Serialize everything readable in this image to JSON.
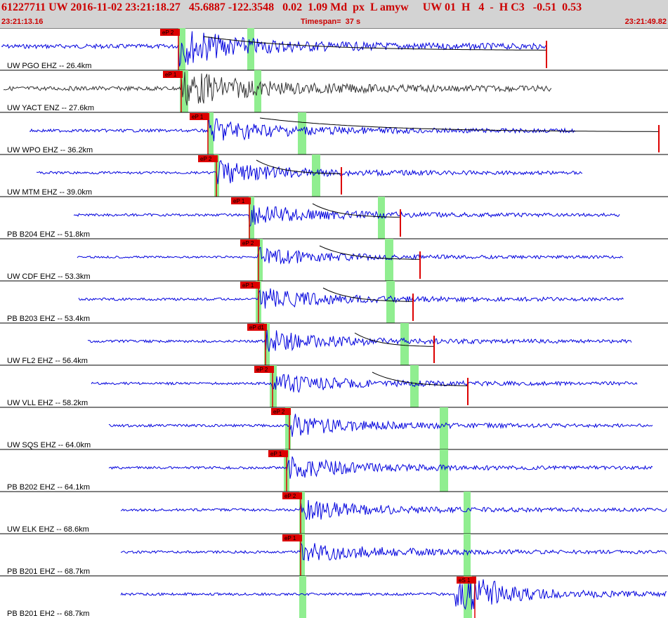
{
  "header": {
    "event_line": "61227711 UW 2016-11-02 23:21:18.27   45.6887 -122.3548   0.02  1.09 Md  px  L amyw     UW 01  H   4  -  H C3   -0.51  0.53",
    "start_time": "23:21:13.16",
    "timespan": "Timespan=  37 s",
    "end_time": "23:21:49.82"
  },
  "colors": {
    "header_bg": "#d3d3d3",
    "header_text": "#cc0000",
    "trace": "#0000dd",
    "trace_alt": "#333333",
    "pick": "#dd0000",
    "window": "#90ee90",
    "decay": "#000000"
  },
  "traces": [
    {
      "label": "UW PGO EHZ -- 26.4km",
      "pick": "eP 2",
      "color": "blue",
      "coda": true
    },
    {
      "label": "UW YACT ENZ -- 27.6km",
      "pick": "eP 1",
      "color": "gray",
      "coda": false
    },
    {
      "label": "UW WPO EHZ -- 36.2km",
      "pick": "eP 1",
      "color": "blue",
      "coda": true
    },
    {
      "label": "UW MTM EHZ -- 39.0km",
      "pick": "eP 2",
      "color": "blue",
      "coda": true
    },
    {
      "label": "PB B204 EHZ -- 51.8km",
      "pick": "eP 1",
      "color": "blue",
      "coda": true
    },
    {
      "label": "UW CDF EHZ -- 53.3km",
      "pick": "eP 2",
      "color": "blue",
      "coda": true
    },
    {
      "label": "PB B203 EHZ -- 53.4km",
      "pick": "eP 1",
      "color": "blue",
      "coda": true
    },
    {
      "label": "UW FL2 EHZ -- 56.4km",
      "pick": "eP d1",
      "color": "blue",
      "coda": true
    },
    {
      "label": "UW VLL EHZ -- 58.2km",
      "pick": "eP 2",
      "color": "blue",
      "coda": true
    },
    {
      "label": "UW SQS EHZ -- 64.0km",
      "pick": "eP 2",
      "color": "blue",
      "coda": false
    },
    {
      "label": "PB B202 EHZ -- 64.1km",
      "pick": "eP 1",
      "color": "blue",
      "coda": false
    },
    {
      "label": "UW ELK EHZ -- 68.6km",
      "pick": "eP 2",
      "color": "blue",
      "coda": false
    },
    {
      "label": "PB B201 EHZ -- 68.7km",
      "pick": "eP 1",
      "color": "blue",
      "coda": false
    },
    {
      "label": "PB B201 EH2 -- 68.7km",
      "pick": "eS 1",
      "color": "blue",
      "coda": false
    }
  ]
}
